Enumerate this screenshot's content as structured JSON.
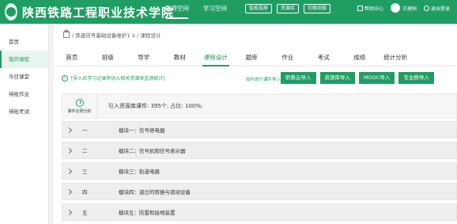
{
  "header": {
    "logo_text": "陕西铁路工程职业技术学院",
    "nav": [
      "教师空间",
      "学习空间"
    ],
    "buttons": [
      "智能投屏",
      "资源库",
      "切换旧版"
    ],
    "help": "帮助中心",
    "user": "王建国",
    "logout": "退出登录"
  },
  "sidebar": {
    "items": [
      "首页",
      "我的课程",
      "今日课堂",
      "待批作业",
      "待批考试"
    ]
  },
  "breadcrumb": "/ 铁道信号基础设备维护1 ∨ / 课程设计",
  "tabs": [
    "首页",
    "班级",
    "导学",
    "教材",
    "课程设计",
    "题库",
    "作业",
    "考试",
    "成绩",
    "统计分析"
  ],
  "notice": {
    "icon": "i",
    "text": "[导入后学习记录将动入相关资源来监测统计]",
    "howto": "如何进行课件导入?"
  },
  "import_buttons": [
    "职教云导入",
    "资源库导入",
    "MOOC导入",
    "专业群导入"
  ],
  "ratio": {
    "label": "课件比例分析",
    "text": "引入资源库课件: 395个, 占比: 100%;"
  },
  "modules": [
    {
      "num": "一",
      "title": "模块一：信号继电器"
    },
    {
      "num": "二",
      "title": "模块二：信号机和信号表示器"
    },
    {
      "num": "三",
      "title": "模块三：轨道电路"
    },
    {
      "num": "四",
      "title": "模块四：道岔的转换与锁闭设备"
    },
    {
      "num": "五",
      "title": "模块五：防雷和接地装置"
    }
  ],
  "colors": {
    "brand": "#1f9d63"
  }
}
